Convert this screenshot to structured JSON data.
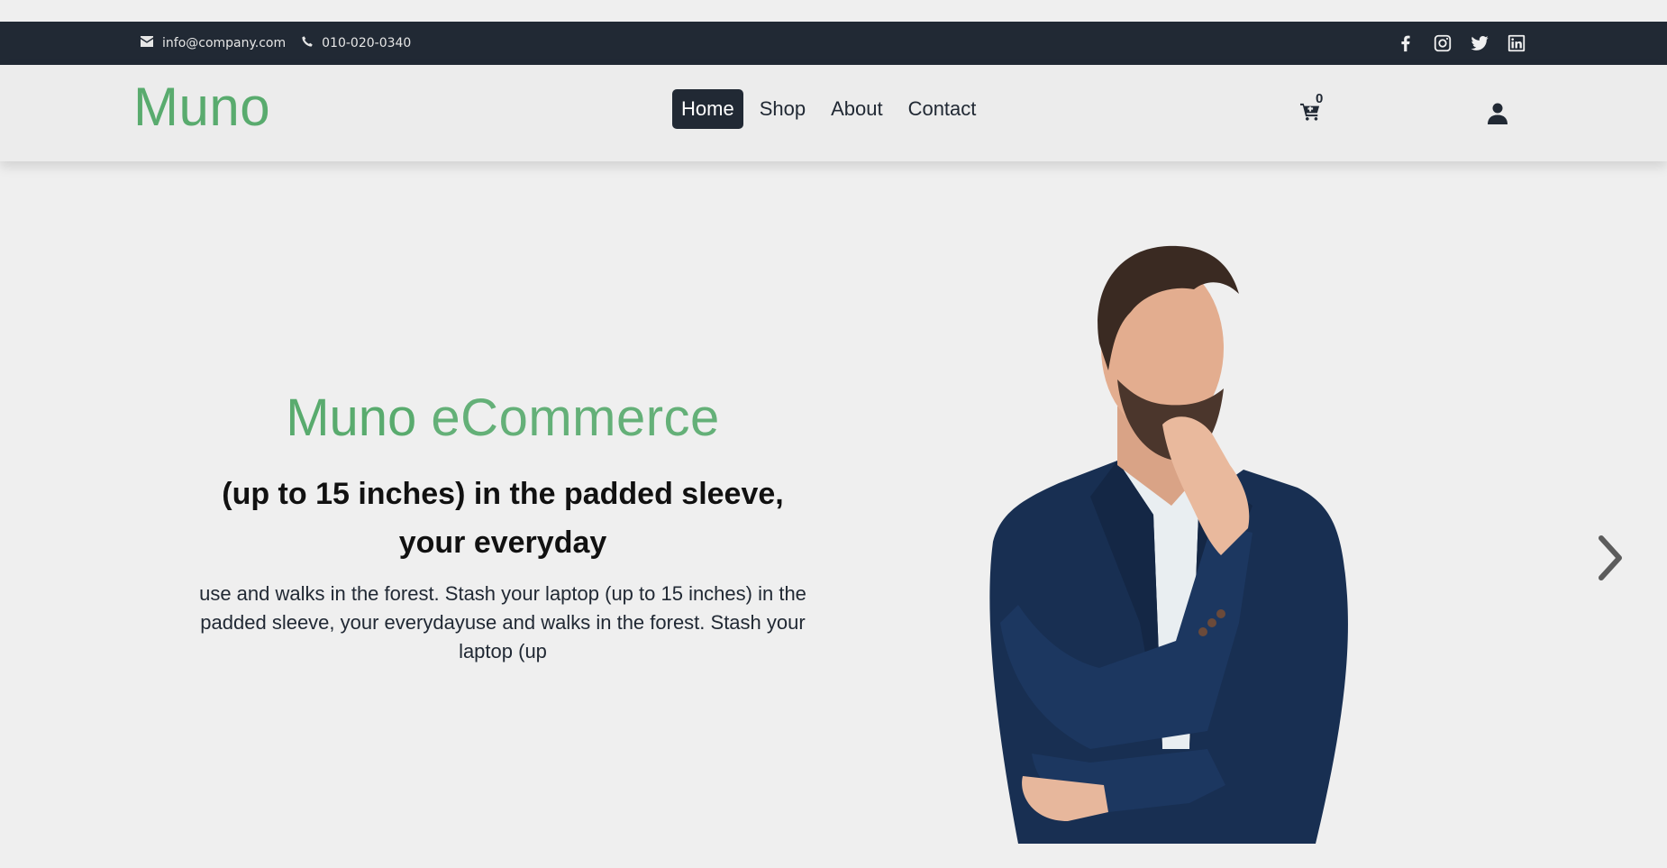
{
  "topbar": {
    "email": "info@company.com",
    "phone": "010-020-0340",
    "icons": {
      "email": "envelope-icon",
      "phone": "phone-icon",
      "socials": [
        "facebook-icon",
        "instagram-icon",
        "twitter-icon",
        "linkedin-icon"
      ]
    }
  },
  "header": {
    "logo": "Muno",
    "nav": [
      {
        "label": "Home",
        "active": true
      },
      {
        "label": "Shop",
        "active": false
      },
      {
        "label": "About",
        "active": false
      },
      {
        "label": "Contact",
        "active": false
      }
    ],
    "cart_count": "0",
    "icons": {
      "cart": "cart-icon",
      "user": "user-icon"
    }
  },
  "hero": {
    "title_strong": "Muno",
    "title_light": "eCommerce",
    "subtitle": "(up to 15 inches) in the padded sleeve, your everyday",
    "description": "use and walks in the forest. Stash your laptop (up to 15 inches) in the padded sleeve, your everydayuse and walks in the forest. Stash your laptop (up",
    "next_icon": "chevron-right-icon"
  },
  "colors": {
    "brand_green": "#59ab6e",
    "dark": "#212934",
    "background": "#efefef"
  }
}
